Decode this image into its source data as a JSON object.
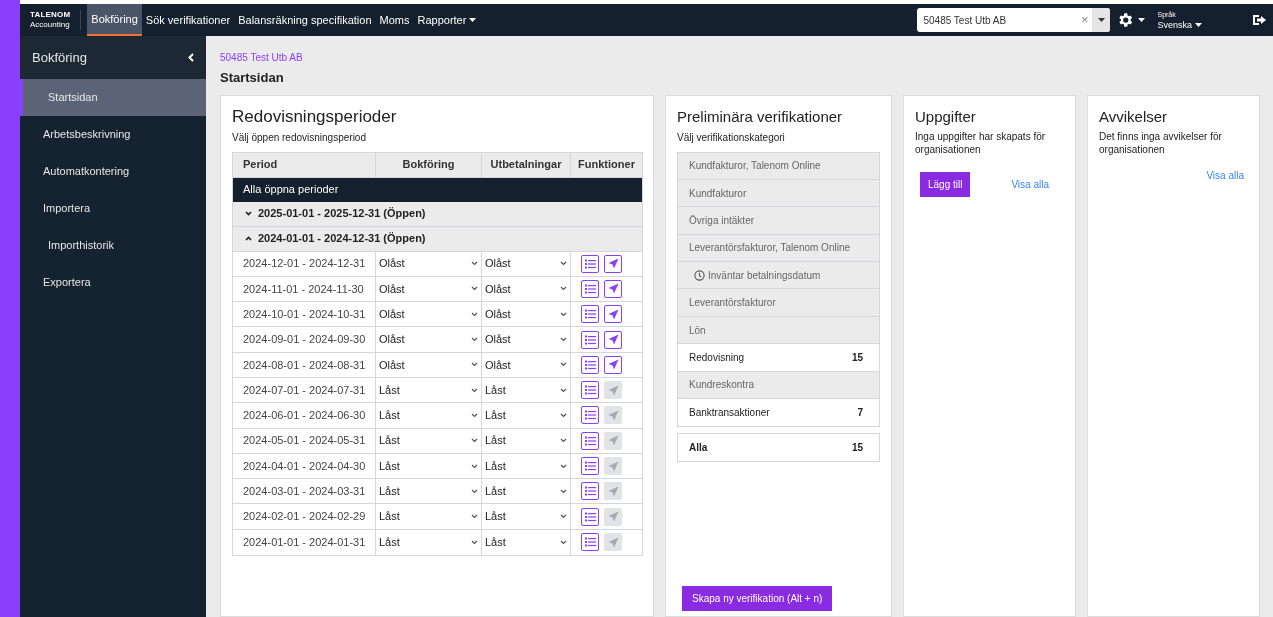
{
  "topbar": {
    "logo": [
      "TALENOM",
      "Accounting"
    ],
    "nav": [
      {
        "label": "Bokföring",
        "selected": true,
        "dropdown": false
      },
      {
        "label": "Sök verifikationer",
        "selected": false,
        "dropdown": false
      },
      {
        "label": "Balansräkning specifikation",
        "selected": false,
        "dropdown": false
      },
      {
        "label": "Moms",
        "selected": false,
        "dropdown": false
      },
      {
        "label": "Rapporter",
        "selected": false,
        "dropdown": true
      }
    ],
    "org_select": {
      "value": "50485 Test Utb AB",
      "clear": "×"
    },
    "language": {
      "label": "Språk",
      "value": "Svenska"
    }
  },
  "sidebar": {
    "title": "Bokföring",
    "items": [
      {
        "label": "Startsidan",
        "selected": true
      },
      {
        "label": "Arbetsbeskrivning",
        "selected": false
      },
      {
        "label": "Automatkontering",
        "selected": false
      },
      {
        "label": "Importera",
        "selected": false,
        "children": [
          {
            "label": "Importhistorik",
            "selected": false
          }
        ]
      },
      {
        "label": "Exportera",
        "selected": false
      }
    ]
  },
  "breadcrumb": "50485 Test Utb AB",
  "page_title": "Startsidan",
  "periods": {
    "title": "Redovisningsperioder",
    "subtitle": "Välj öppen redovisningsperiod",
    "columns": [
      "Period",
      "Bokföring",
      "Utbetalningar",
      "Funktioner"
    ],
    "all_row": "Alla öppna perioder",
    "groups": [
      {
        "label": "2025-01-01 - 2025-12-31 (Öppen)",
        "expanded": false
      },
      {
        "label": "2024-01-01 - 2024-12-31 (Öppen)",
        "expanded": true,
        "children": [
          {
            "period": "2024-12-01 - 2024-12-31",
            "bookkeeping": "Olåst",
            "payments": "Olåst",
            "send_disabled": false
          },
          {
            "period": "2024-11-01 - 2024-11-30",
            "bookkeeping": "Olåst",
            "payments": "Olåst",
            "send_disabled": false
          },
          {
            "period": "2024-10-01 - 2024-10-31",
            "bookkeeping": "Olåst",
            "payments": "Olåst",
            "send_disabled": false
          },
          {
            "period": "2024-09-01 - 2024-09-30",
            "bookkeeping": "Olåst",
            "payments": "Olåst",
            "send_disabled": false
          },
          {
            "period": "2024-08-01 - 2024-08-31",
            "bookkeeping": "Olåst",
            "payments": "Olåst",
            "send_disabled": false
          },
          {
            "period": "2024-07-01 - 2024-07-31",
            "bookkeeping": "Låst",
            "payments": "Låst",
            "send_disabled": true
          },
          {
            "period": "2024-06-01 - 2024-06-30",
            "bookkeeping": "Låst",
            "payments": "Låst",
            "send_disabled": true
          },
          {
            "period": "2024-05-01 - 2024-05-31",
            "bookkeeping": "Låst",
            "payments": "Låst",
            "send_disabled": true
          },
          {
            "period": "2024-04-01 - 2024-04-30",
            "bookkeeping": "Låst",
            "payments": "Låst",
            "send_disabled": true
          },
          {
            "period": "2024-03-01 - 2024-03-31",
            "bookkeeping": "Låst",
            "payments": "Låst",
            "send_disabled": true
          },
          {
            "period": "2024-02-01 - 2024-02-29",
            "bookkeeping": "Låst",
            "payments": "Låst",
            "send_disabled": true
          },
          {
            "period": "2024-01-01 - 2024-01-31",
            "bookkeeping": "Låst",
            "payments": "Låst",
            "send_disabled": true
          }
        ]
      }
    ]
  },
  "preliminary": {
    "title": "Preliminära verifikationer",
    "subtitle": "Välj verifikationskategori",
    "categories": [
      {
        "kind": "category",
        "label": "Kundfakturor, Talenom Online",
        "active": false
      },
      {
        "kind": "category",
        "label": "Kundfakturor",
        "active": false
      },
      {
        "kind": "category",
        "label": "Övriga intäkter",
        "active": false
      },
      {
        "kind": "category",
        "label": "Leverantörsfakturor, Talenom Online",
        "active": false
      },
      {
        "kind": "waiting",
        "label": "Inväntar betalningsdatum",
        "active": false
      },
      {
        "kind": "category",
        "label": "Leverantörsfakturor",
        "active": false
      },
      {
        "kind": "category",
        "label": "Lön",
        "active": false
      },
      {
        "kind": "category",
        "label": "Redovisning",
        "active": true,
        "count": "15"
      },
      {
        "kind": "category",
        "label": "Kundreskontra",
        "active": false
      },
      {
        "kind": "category",
        "label": "Banktransaktioner",
        "active": true,
        "count": "7"
      }
    ],
    "all": {
      "label": "Alla",
      "count": "15"
    },
    "create_button": "Skapa ny verifikation (Alt + n)"
  },
  "tasks": {
    "title": "Uppgifter",
    "message": "Inga uppgifter har skapats för organisationen",
    "add_button": "Lägg till",
    "link": "Visa alla"
  },
  "deviations": {
    "title": "Avvikelser",
    "message": "Det finns inga avvikelser för organisationen",
    "link": "Visa alla"
  }
}
